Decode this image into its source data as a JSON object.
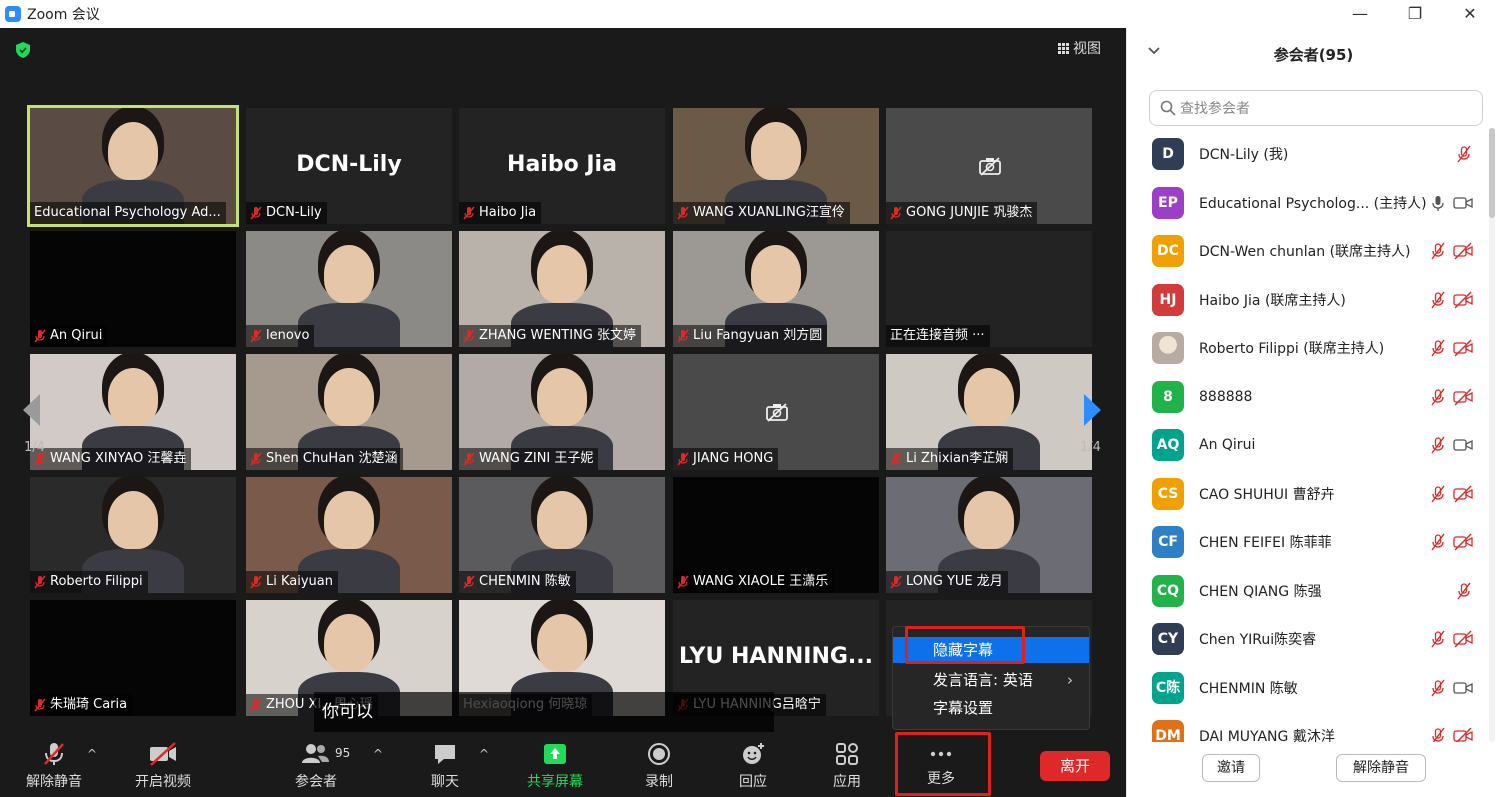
{
  "window": {
    "title": "Zoom 会议",
    "controls": [
      "—",
      "❐",
      "✕"
    ]
  },
  "view_label": "视图",
  "tiles": [
    {
      "label": "Educational Psychology  Ad...",
      "bigname": "",
      "muted": false,
      "style": "photo",
      "active": true
    },
    {
      "label": "DCN-Lily",
      "bigname": "DCN-Lily",
      "muted": true,
      "style": "dark"
    },
    {
      "label": "Haibo Jia",
      "bigname": "Haibo Jia",
      "muted": true,
      "style": "dark"
    },
    {
      "label": "WANG XUANLING汪宣伶",
      "bigname": "",
      "muted": true,
      "style": "photo"
    },
    {
      "label": "GONG JUNJIE 巩骏杰",
      "bigname": "",
      "muted": true,
      "style": "gray"
    },
    {
      "label": "An Qirui",
      "bigname": "",
      "muted": true,
      "style": "black"
    },
    {
      "label": "lenovo",
      "bigname": "",
      "muted": true,
      "style": "photo"
    },
    {
      "label": "ZHANG WENTING 张文婷",
      "bigname": "",
      "muted": true,
      "style": "photo"
    },
    {
      "label": "Liu Fangyuan 刘方圆",
      "bigname": "",
      "muted": true,
      "style": "photo"
    },
    {
      "label": "正在连接音频 ···",
      "bigname": "",
      "muted": false,
      "style": "dark"
    },
    {
      "label": "WANG XINYAO 汪馨垚",
      "bigname": "",
      "muted": true,
      "style": "photo"
    },
    {
      "label": "Shen ChuHan 沈楚涵",
      "bigname": "",
      "muted": true,
      "style": "photo"
    },
    {
      "label": "WANG ZINI 王子妮",
      "bigname": "",
      "muted": true,
      "style": "photo"
    },
    {
      "label": "JIANG HONG",
      "bigname": "",
      "muted": true,
      "style": "gray"
    },
    {
      "label": "Li Zhixian李芷娴",
      "bigname": "",
      "muted": true,
      "style": "photo"
    },
    {
      "label": "Roberto Filippi",
      "bigname": "",
      "muted": true,
      "style": "photo"
    },
    {
      "label": "Li Kaiyuan",
      "bigname": "",
      "muted": true,
      "style": "photo"
    },
    {
      "label": "CHENMIN 陈敏",
      "bigname": "",
      "muted": true,
      "style": "photo"
    },
    {
      "label": "WANG XIAOLE 王潇乐",
      "bigname": "",
      "muted": true,
      "style": "black"
    },
    {
      "label": "LONG YUE 龙月",
      "bigname": "",
      "muted": true,
      "style": "photo"
    },
    {
      "label": "朱瑞琦 Caria",
      "bigname": "",
      "muted": true,
      "style": "black"
    },
    {
      "label": "ZHOU XI...周心瑶",
      "bigname": "",
      "muted": true,
      "style": "photo"
    },
    {
      "label": "Hexiaoqiong 何晓琼",
      "bigname": "",
      "muted": false,
      "style": "photo"
    },
    {
      "label": "LYU HANNING吕晗宁",
      "bigname": "LYU  HANNING...",
      "muted": true,
      "style": "dark"
    },
    {
      "label": "",
      "bigname": "",
      "muted": false,
      "style": "dark"
    }
  ],
  "page_indicator": "1/4",
  "caption_text": "你可以",
  "caption_menu": {
    "items": [
      "隐藏字幕",
      "发言语言:   英语",
      "字幕设置"
    ],
    "chevron": "›"
  },
  "toolbar": {
    "unmute": "解除静音",
    "start_video": "开启视频",
    "participants": "参会者",
    "participants_count": "95",
    "chat": "聊天",
    "share": "共享屏幕",
    "record": "录制",
    "reactions": "回应",
    "apps": "应用",
    "more": "更多",
    "leave": "离开"
  },
  "panel": {
    "title": "参会者(95)",
    "search_placeholder": "查找参会者",
    "invite": "邀请",
    "unmute_all": "解除静音",
    "participants": [
      {
        "initials": "D",
        "color": "#2f3e55",
        "name": "DCN-Lily (我)",
        "mic": "muted",
        "video": "none"
      },
      {
        "initials": "EP",
        "color": "#9b3fc7",
        "name": "Educational Psycholog... (主持人)",
        "mic": "on",
        "video": "on"
      },
      {
        "initials": "DC",
        "color": "#f0a000",
        "name": "DCN-Wen chunlan (联席主持人)",
        "mic": "muted",
        "video": "off"
      },
      {
        "initials": "HJ",
        "color": "#d23b3b",
        "name": "Haibo Jia (联席主持人)",
        "mic": "muted",
        "video": "off"
      },
      {
        "initials": "",
        "color": "#cfc8c0",
        "name": "Roberto Filippi (联席主持人)",
        "mic": "muted",
        "video": "off"
      },
      {
        "initials": "8",
        "color": "#21b34a",
        "name": "888888",
        "mic": "muted",
        "video": "off"
      },
      {
        "initials": "AQ",
        "color": "#00a38c",
        "name": "An Qirui",
        "mic": "muted",
        "video": "on"
      },
      {
        "initials": "CS",
        "color": "#f0a000",
        "name": "CAO SHUHUI 曹舒卉",
        "mic": "muted",
        "video": "off"
      },
      {
        "initials": "CF",
        "color": "#2f7fc4",
        "name": "CHEN FEIFEI 陈菲菲",
        "mic": "muted",
        "video": "off"
      },
      {
        "initials": "CQ",
        "color": "#21b34a",
        "name": "CHEN QIANG 陈强",
        "mic": "muted",
        "video": "none"
      },
      {
        "initials": "CY",
        "color": "#2f3e55",
        "name": "Chen YIRui陈奕睿",
        "mic": "muted",
        "video": "off"
      },
      {
        "initials": "C陈",
        "color": "#00a38c",
        "name": "CHENMIN 陈敏",
        "mic": "muted",
        "video": "on"
      },
      {
        "initials": "DM",
        "color": "#e0711a",
        "name": "DAI MUYANG 戴沐洋",
        "mic": "muted",
        "video": "off"
      }
    ]
  }
}
